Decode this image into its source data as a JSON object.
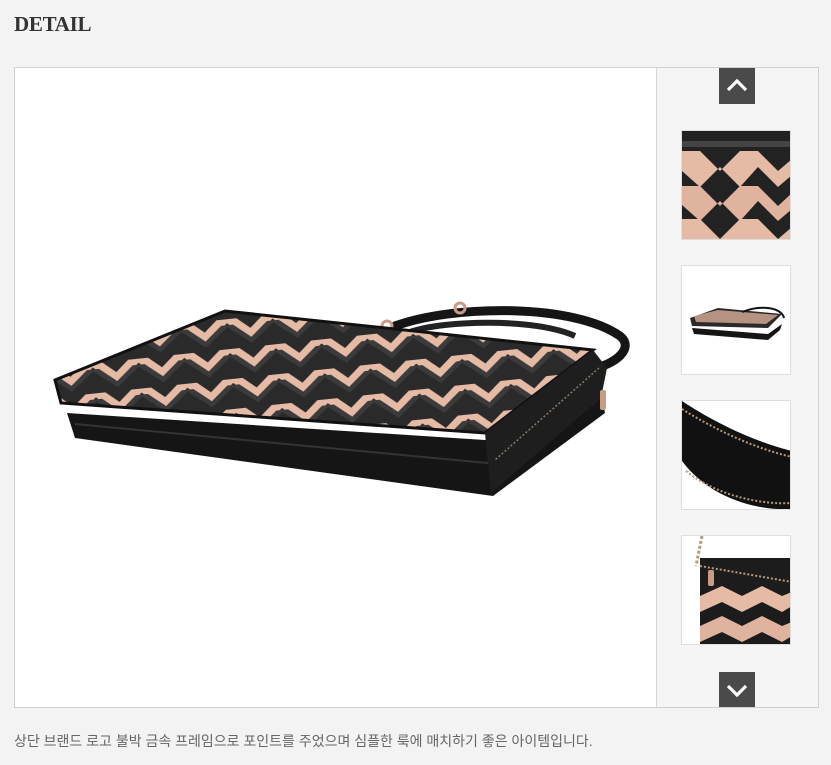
{
  "section": {
    "title": "DETAIL"
  },
  "gallery": {
    "main_image": "crossbody clutch bag with rose-gold chevron panels and black strap",
    "nav_up_icon": "chevron-up-icon",
    "nav_down_icon": "chevron-down-icon",
    "thumbnails": [
      {
        "content": "front chevron panel close-up"
      },
      {
        "content": "full bag view"
      },
      {
        "content": "inner zip pocket close-up"
      },
      {
        "content": "side zipper detail"
      }
    ]
  },
  "description": {
    "text": "상단 브랜드 로고 불박 금속 프레임으로 포인트를 주었으며 심플한 룩에 매치하기 좋은 아이템입니다."
  },
  "colors": {
    "background": "#f3f3f3",
    "nav_button": "#4a4a4a",
    "rose_gold": "#e2b6a0",
    "bag_black": "#1a1a1a"
  }
}
